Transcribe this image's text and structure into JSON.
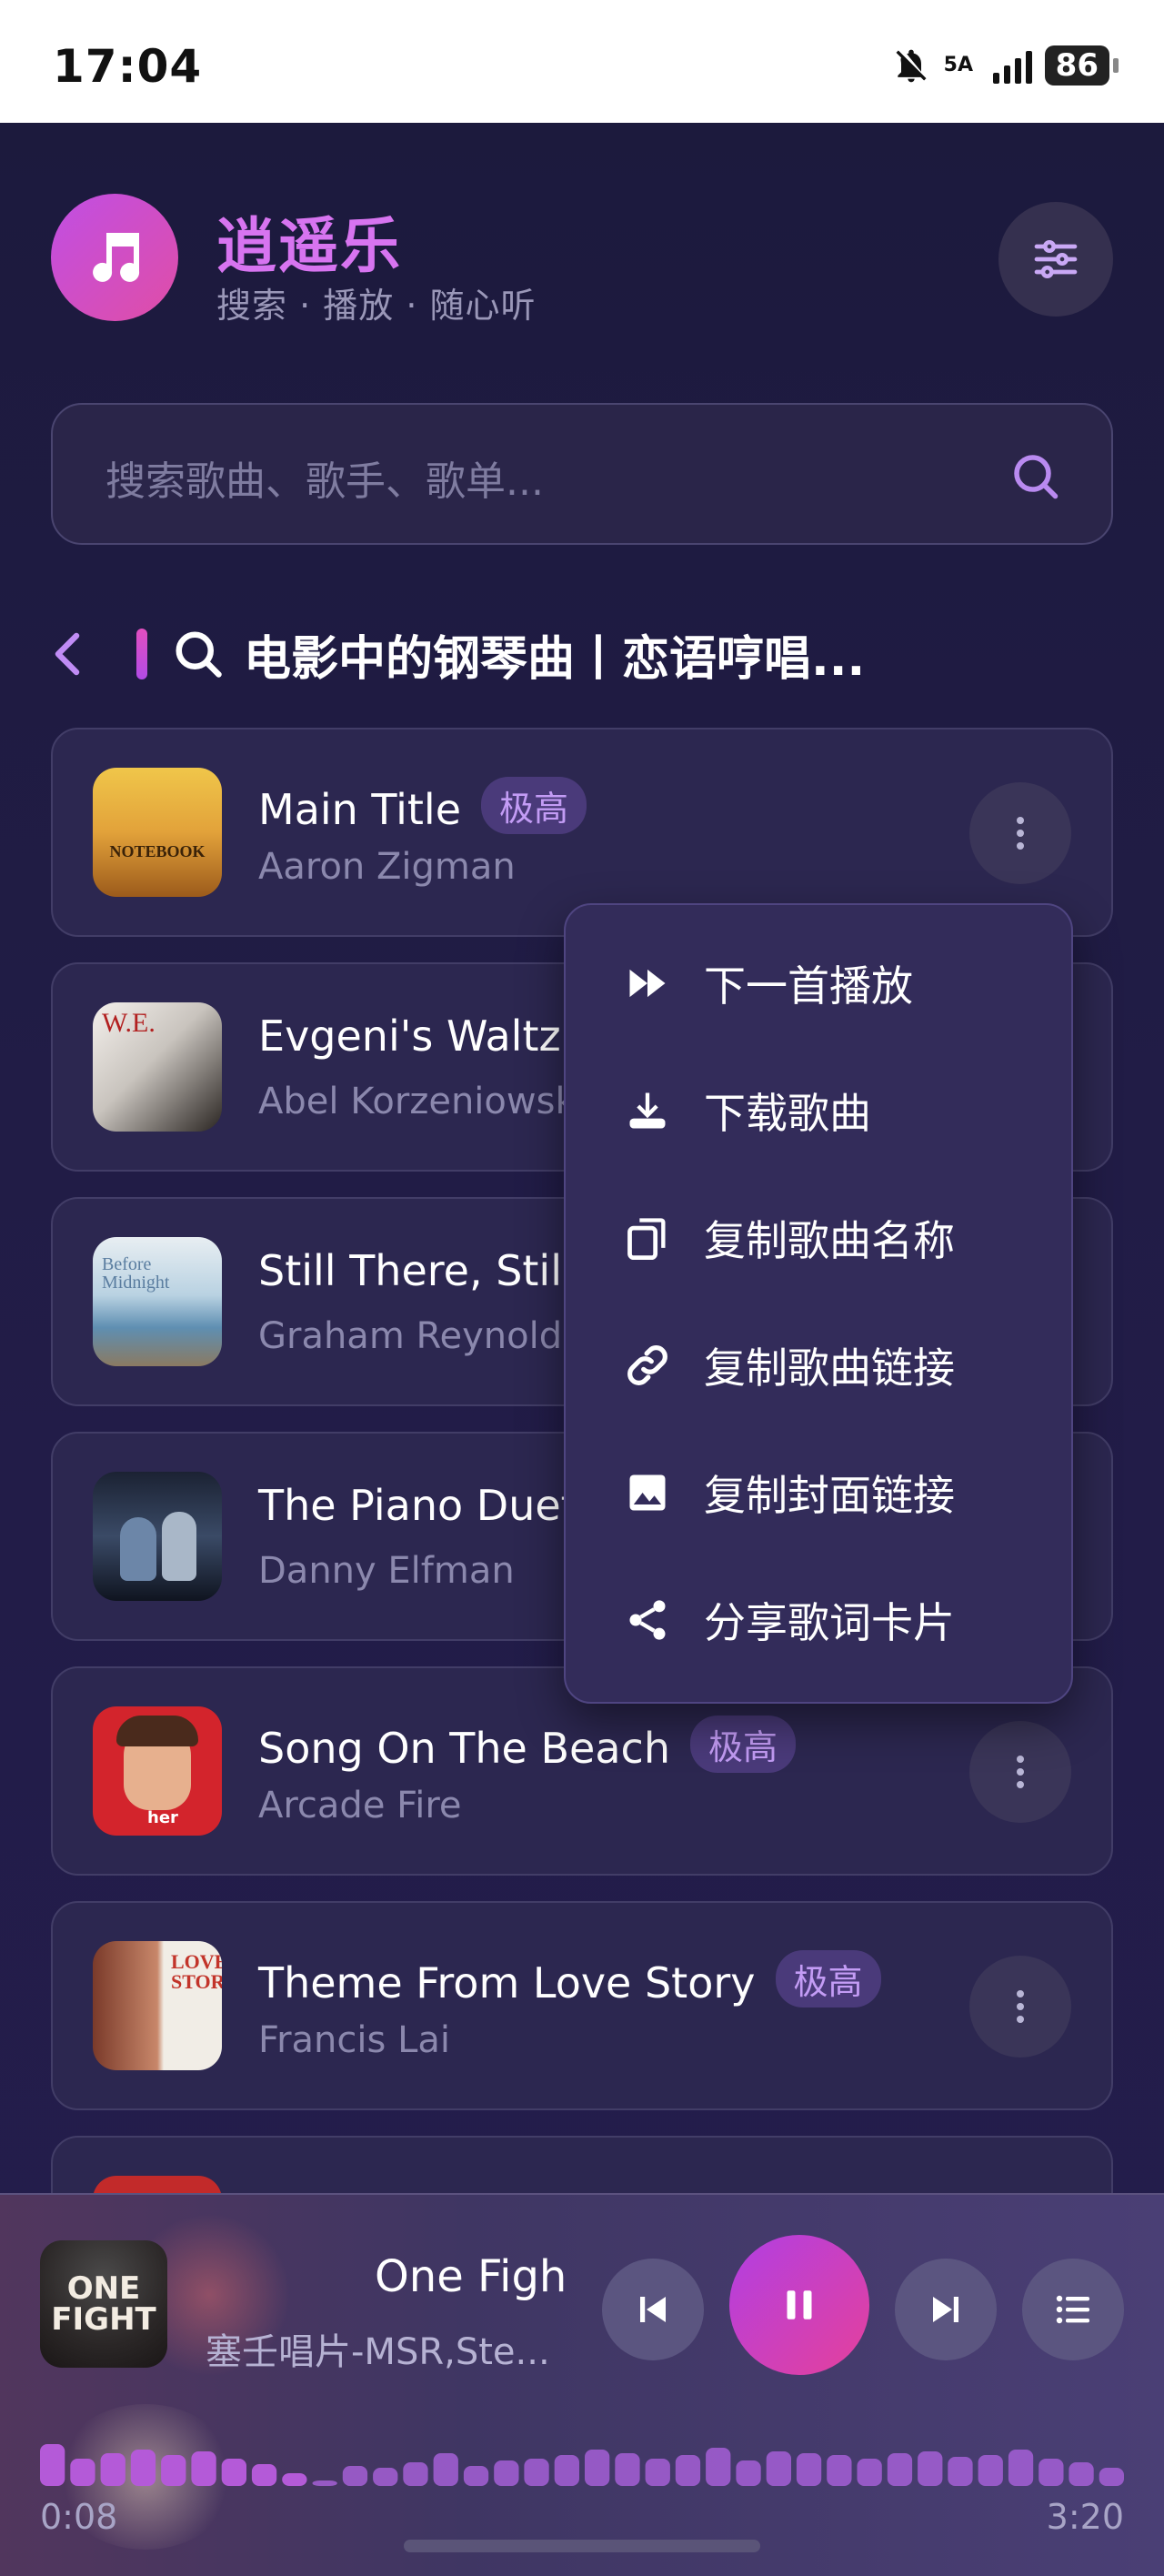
{
  "status_bar": {
    "time": "17:04",
    "network": "5A",
    "battery": "86"
  },
  "header": {
    "title": "逍遥乐",
    "subtitle": "搜索 · 播放 · 随心听"
  },
  "search": {
    "placeholder": "搜索歌曲、歌手、歌单..."
  },
  "breadcrumb": {
    "query": "电影中的钢琴曲丨恋语哼唱..."
  },
  "songs": [
    {
      "title": "Main Title",
      "artist": "Aaron Zigman",
      "badge": "极高"
    },
    {
      "title": "Evgeni's Waltz",
      "artist": "Abel Korzeniowski",
      "badge": ""
    },
    {
      "title": "Still There, Still",
      "artist": "Graham Reynolds",
      "badge": ""
    },
    {
      "title": "The Piano Duet",
      "artist": "Danny Elfman",
      "badge": ""
    },
    {
      "title": "Song On The Beach",
      "artist": "Arcade Fire",
      "badge": "极高"
    },
    {
      "title": "Theme From Love Story",
      "artist": "Francis Lai",
      "badge": "极高"
    }
  ],
  "context_menu": {
    "items": [
      {
        "label": "下一首播放",
        "icon": "play-next-icon"
      },
      {
        "label": "下载歌曲",
        "icon": "download-icon"
      },
      {
        "label": "复制歌曲名称",
        "icon": "copy-icon"
      },
      {
        "label": "复制歌曲链接",
        "icon": "link-icon"
      },
      {
        "label": "复制封面链接",
        "icon": "image-icon"
      },
      {
        "label": "分享歌词卡片",
        "icon": "share-icon"
      }
    ]
  },
  "player": {
    "title": "One Figh",
    "artist": "塞壬唱片-MSR,Ste...",
    "current_time": "0:08",
    "total_time": "3:20",
    "progress": 0.04,
    "cover_text": "ONE FIGHT",
    "state": "playing"
  },
  "colors": {
    "accent_pink": "#e04da6",
    "accent_purple": "#c04fe4",
    "title_color": "#d774f0",
    "badge_bg": "#4a3a7a",
    "badge_text": "#c39cf5"
  }
}
